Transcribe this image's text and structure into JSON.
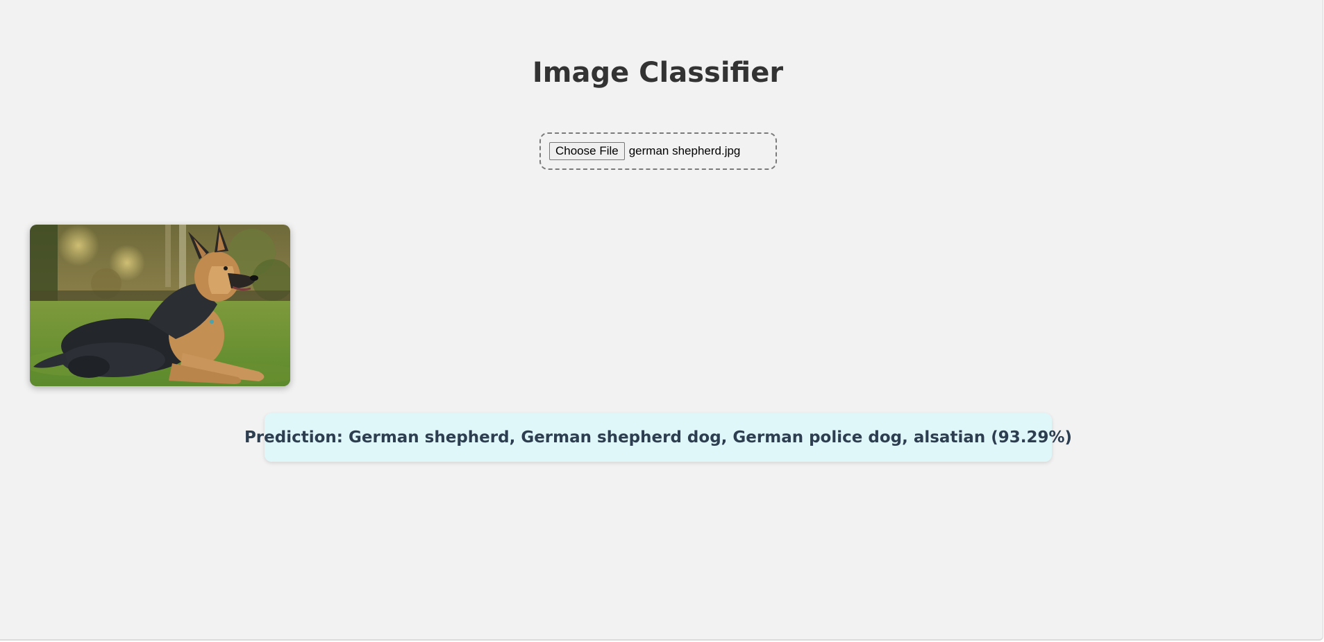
{
  "app": {
    "title": "Image Classifier"
  },
  "upload": {
    "button_label": "Choose File",
    "file_name": "german shepherd.jpg"
  },
  "preview": {
    "subject": "german-shepherd-photo"
  },
  "result": {
    "text": "Prediction: German shepherd, German shepherd dog, German police dog, alsatian (93.29%)",
    "confidence_percent": 93.29
  },
  "colors": {
    "page_background": "#f2f2f2",
    "title_text": "#333333",
    "prediction_background": "#e0f7fa",
    "prediction_text": "#2c3e50",
    "upload_border": "#7a7a7a"
  }
}
